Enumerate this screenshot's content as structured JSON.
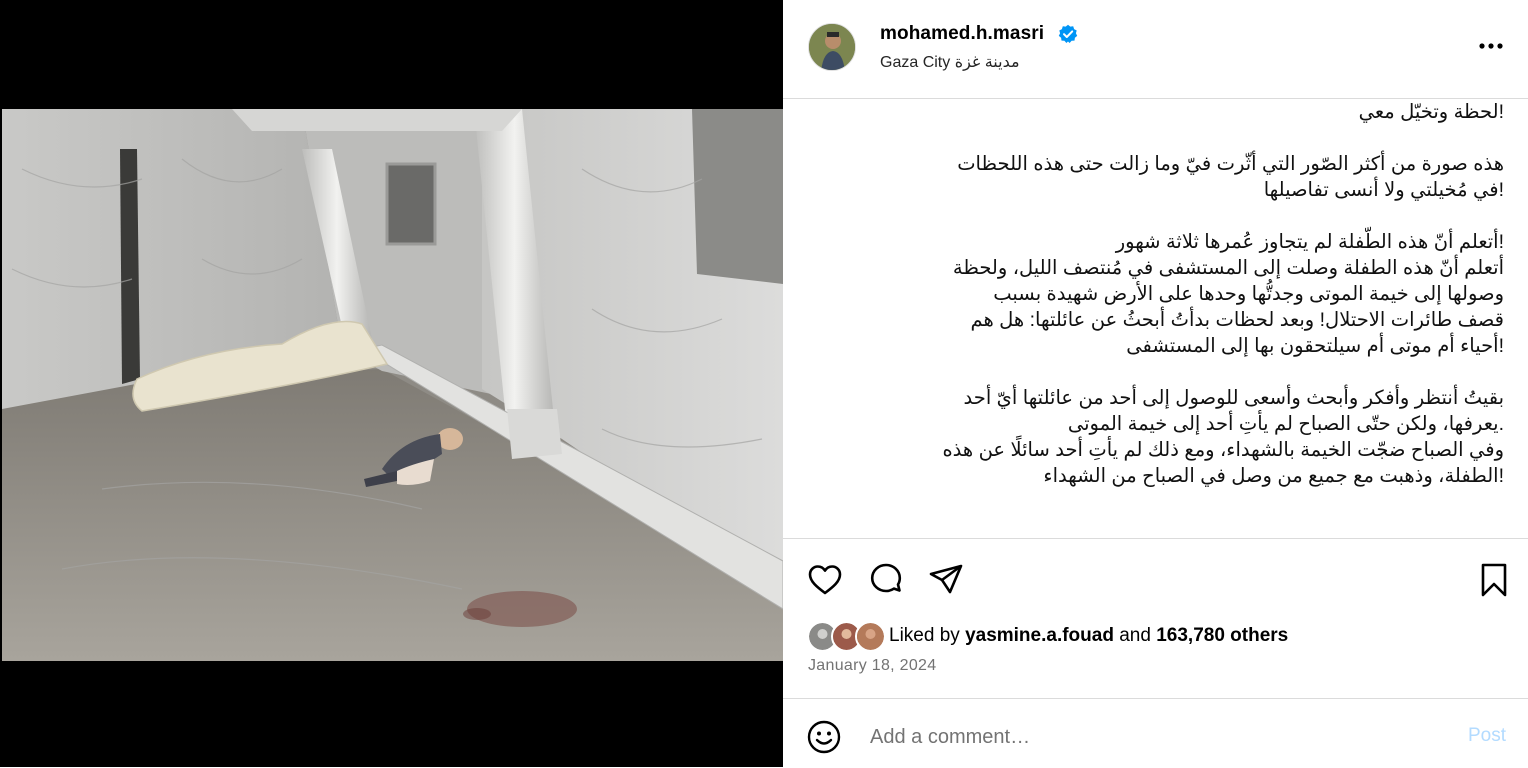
{
  "header": {
    "username": "mohamed.h.masri",
    "location": "Gaza City مدينة غزة",
    "verified_color": "#0095f6"
  },
  "caption": {
    "text": "!لحظة وتخيّل معي\n\nهذه صورة من أكثر الصّور التي أثّرت فيّ وما زالت حتى هذه اللحظات\n!في مُخيلتي ولا أنسى تفاصيلها\n\n!أتعلم أنّ هذه الطّفلة لم يتجاوز عُمرها ثلاثة شهور\nأتعلم أنّ هذه الطفلة وصلت إلى المستشفى في مُنتصف الليل، ولحظة\nوصولها إلى خيمة الموتى وجدتُّها وحدها على الأرض شهيدة بسبب\nقصف طائرات الاحتلال! وبعد لحظات بدأتُ أبحثُ عن عائلتها: هل هم\n!أحياء أم موتى أم سيلتحقون بها إلى المستشفى\n\nبقيتُ أنتظر وأفكر وأبحث وأسعى للوصول إلى أحد من عائلتها أيّ أحد\n.يعرفها، ولكن حتّى الصباح لم يأتِ أحد إلى خيمة الموتى\nوفي الصباح ضجّت الخيمة بالشهداء، ومع ذلك لم يأتِ أحد سائلًا عن هذه\n!الطفلة، وذهبت مع جميع من وصل في الصباح من الشهداء"
  },
  "actions": {
    "icons": [
      "heart-icon",
      "comment-icon",
      "share-icon",
      "bookmark-icon"
    ]
  },
  "likes": {
    "prefix": "Liked by",
    "user": "yasmine.a.fouad",
    "joiner": "and",
    "others": "163,780 others"
  },
  "date": "January 18, 2024",
  "comment": {
    "placeholder": "Add a comment…",
    "post_label": "Post",
    "post_color": "#b3dbff"
  }
}
